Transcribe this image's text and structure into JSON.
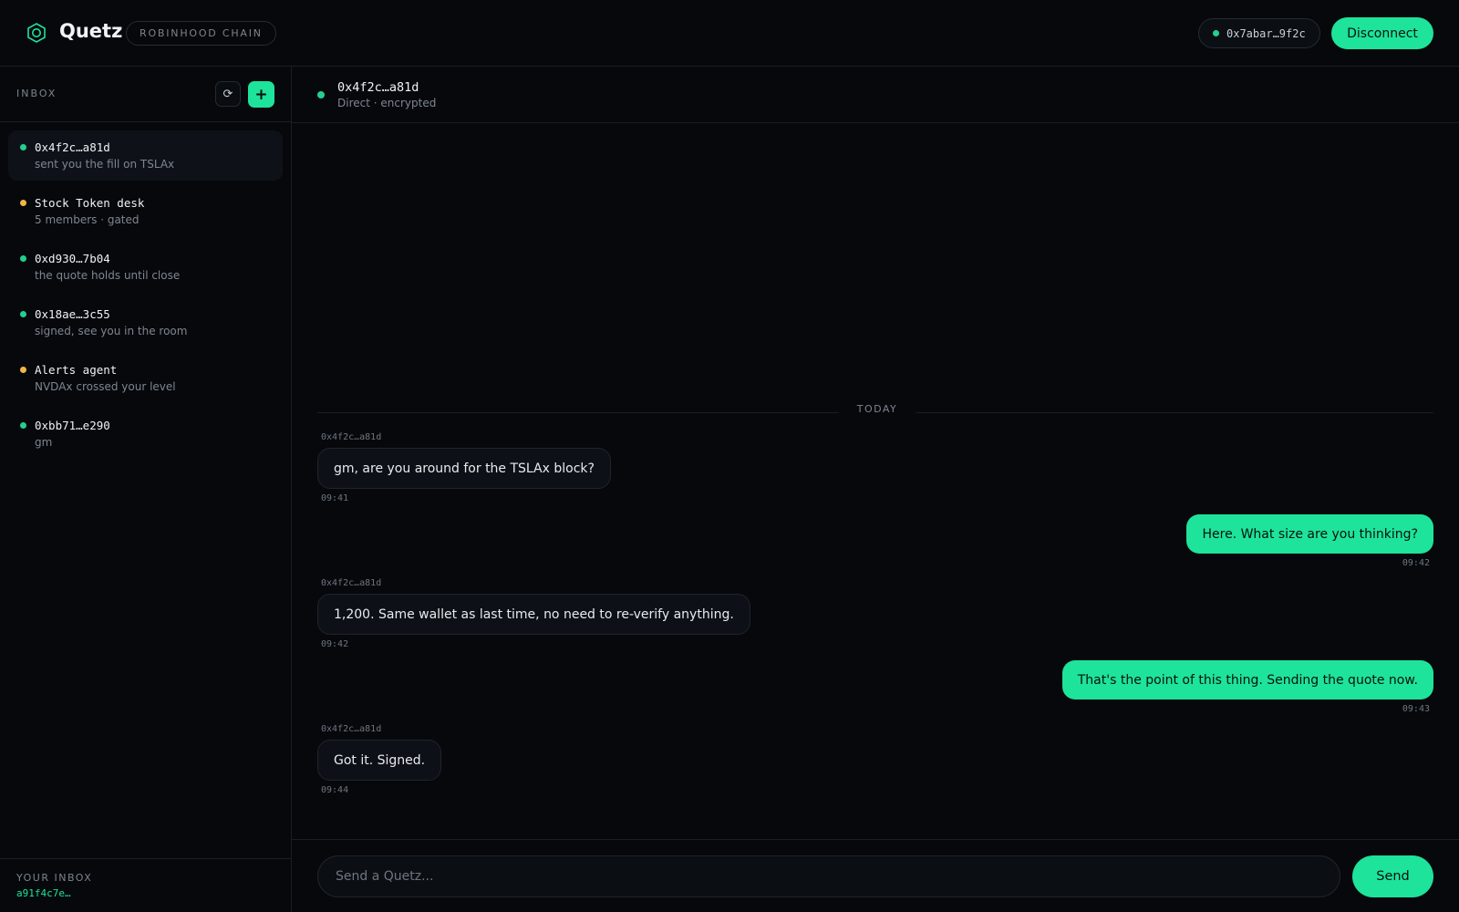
{
  "header": {
    "app_title": "Quetz",
    "chain_badge": "ROBINHOOD CHAIN",
    "wallet": "0x7abar…9f2c",
    "disconnect_label": "Disconnect",
    "logo_icon": "hexagon-logo-icon",
    "accent_color": "#1ee39b"
  },
  "sidebar": {
    "inbox_title": "INBOX",
    "refresh_icon": "⟳",
    "new_icon": "+",
    "conversations": [
      {
        "name": "0x4f2c…a81d",
        "preview": "sent you the fill on TSLAx",
        "status_color": "#22d18f",
        "active": true
      },
      {
        "name": "Stock Token desk",
        "preview": "5 members · gated",
        "status_color": "#f5b545",
        "active": false
      },
      {
        "name": "0xd930…7b04",
        "preview": "the quote holds until close",
        "status_color": "#22d18f",
        "active": false
      },
      {
        "name": "0x18ae…3c55",
        "preview": "signed, see you in the room",
        "status_color": "#22d18f",
        "active": false
      },
      {
        "name": "Alerts agent",
        "preview": "NVDAx crossed your level",
        "status_color": "#f5b545",
        "active": false
      },
      {
        "name": "0xbb71…e290",
        "preview": "gm",
        "status_color": "#22d18f",
        "active": false
      }
    ],
    "footer_label": "YOUR INBOX",
    "footer_value": "a91f4c7e…"
  },
  "chat": {
    "name": "0x4f2c…a81d",
    "subtitle": "Direct · encrypted",
    "divider": "TODAY",
    "messages": [
      {
        "sender": "0x4f2c…a81d",
        "text": "gm, are you around for the TSLAx block?",
        "time": "09:41"
      },
      {
        "text": "Here. What size are you thinking?",
        "time": "09:42"
      },
      {
        "sender": "0x4f2c…a81d",
        "text": "1,200. Same wallet as last time, no need to re-verify anything.",
        "time": "09:42"
      },
      {
        "text": "That's the point of this thing. Sending the quote now.",
        "time": "09:43"
      },
      {
        "sender": "0x4f2c…a81d",
        "text": "Got it. Signed.",
        "time": "09:44"
      }
    ]
  },
  "composer": {
    "placeholder": "Send a Quetz...",
    "send_label": "Send"
  }
}
